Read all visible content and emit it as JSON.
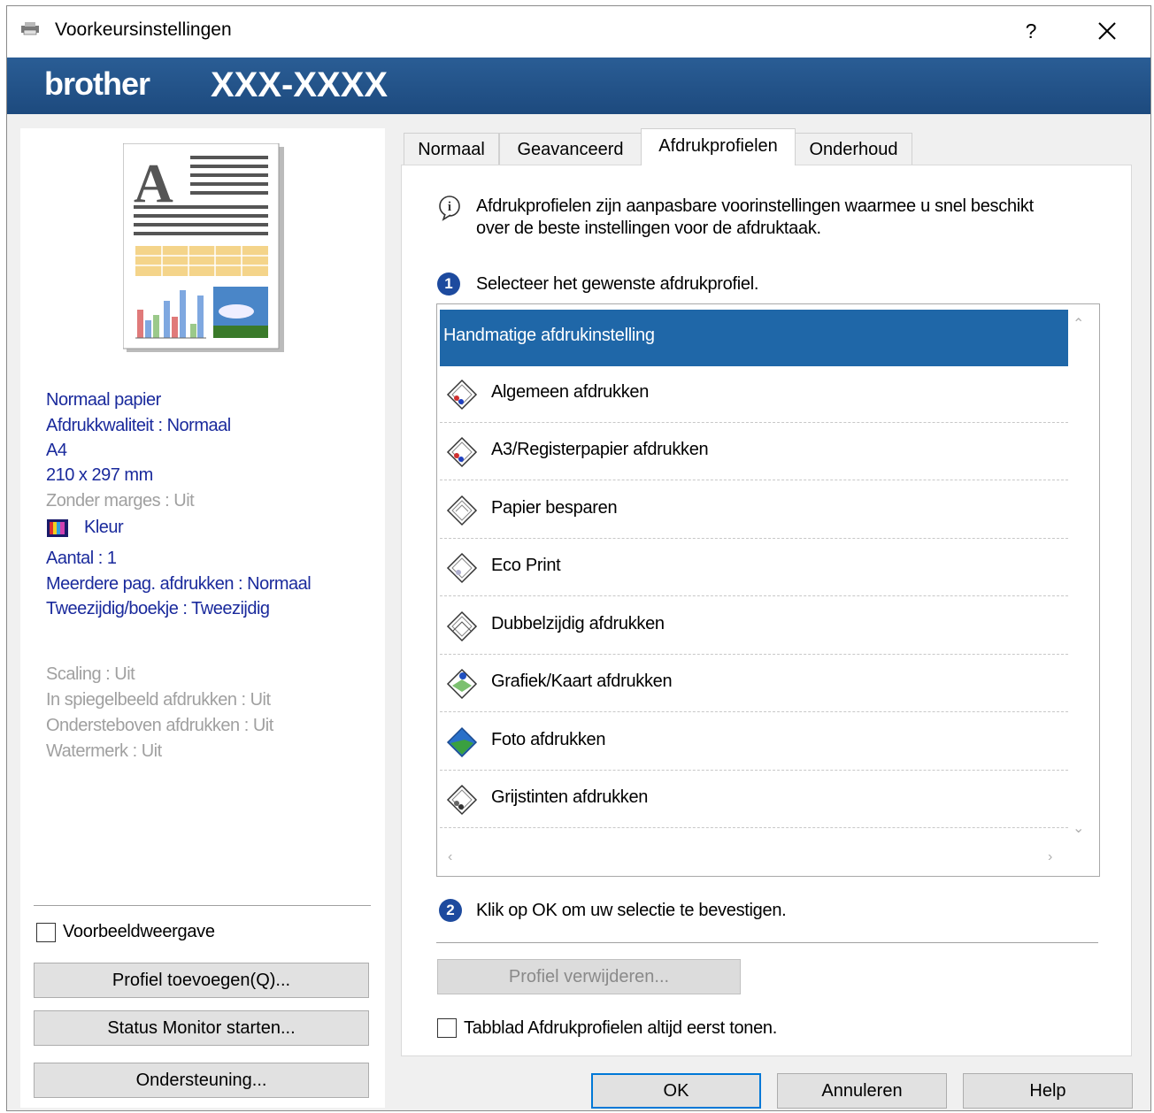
{
  "window": {
    "title": "Voorkeursinstellingen",
    "help": "?",
    "close": "×"
  },
  "banner": {
    "brand": "brother",
    "model": "XXX-XXXX"
  },
  "summary": {
    "media": "Normaal papier",
    "quality": "Afdrukkwaliteit : Normaal",
    "paper": "A4",
    "size": "210 x 297 mm",
    "borderless": "Zonder marges : Uit",
    "color": "Kleur",
    "copies": "Aantal : 1",
    "multipage": "Meerdere pag. afdrukken : Normaal",
    "duplex": "Tweezijdig/boekje : Tweezijdig",
    "scaling": "Scaling : Uit",
    "mirror": "In spiegelbeeld afdrukken : Uit",
    "reverse": "Ondersteboven afdrukken : Uit",
    "watermark": "Watermerk : Uit"
  },
  "left": {
    "preview_label": "Voorbeeldweergave",
    "add_profile": "Profiel toevoegen(Q)...",
    "status_monitor": "Status Monitor starten...",
    "support": "Ondersteuning..."
  },
  "tabs": [
    "Normaal",
    "Geavanceerd",
    "Afdrukprofielen",
    "Onderhoud"
  ],
  "profiles_page": {
    "info": "Afdrukprofielen zijn aanpasbare voorinstellingen waarmee u snel beschikt",
    "info2": "over de beste instellingen voor de afdruktaak.",
    "step1_num": "1",
    "step1": "Selecteer het gewenste afdrukprofiel.",
    "items": [
      "Handmatige afdrukinstelling",
      "Algemeen afdrukken",
      "A3/Registerpapier afdrukken",
      "Papier besparen",
      "Eco Print",
      "Dubbelzijdig afdrukken",
      "Grafiek/Kaart afdrukken",
      "Foto afdrukken",
      "Grijstinten afdrukken"
    ],
    "step2_num": "2",
    "step2": "Klik op OK om uw selectie te bevestigen.",
    "delete_profile": "Profiel verwijderen...",
    "always_show": "Tabblad Afdrukprofielen altijd eerst tonen."
  },
  "footer": {
    "ok": "OK",
    "cancel": "Annuleren",
    "help": "Help"
  }
}
